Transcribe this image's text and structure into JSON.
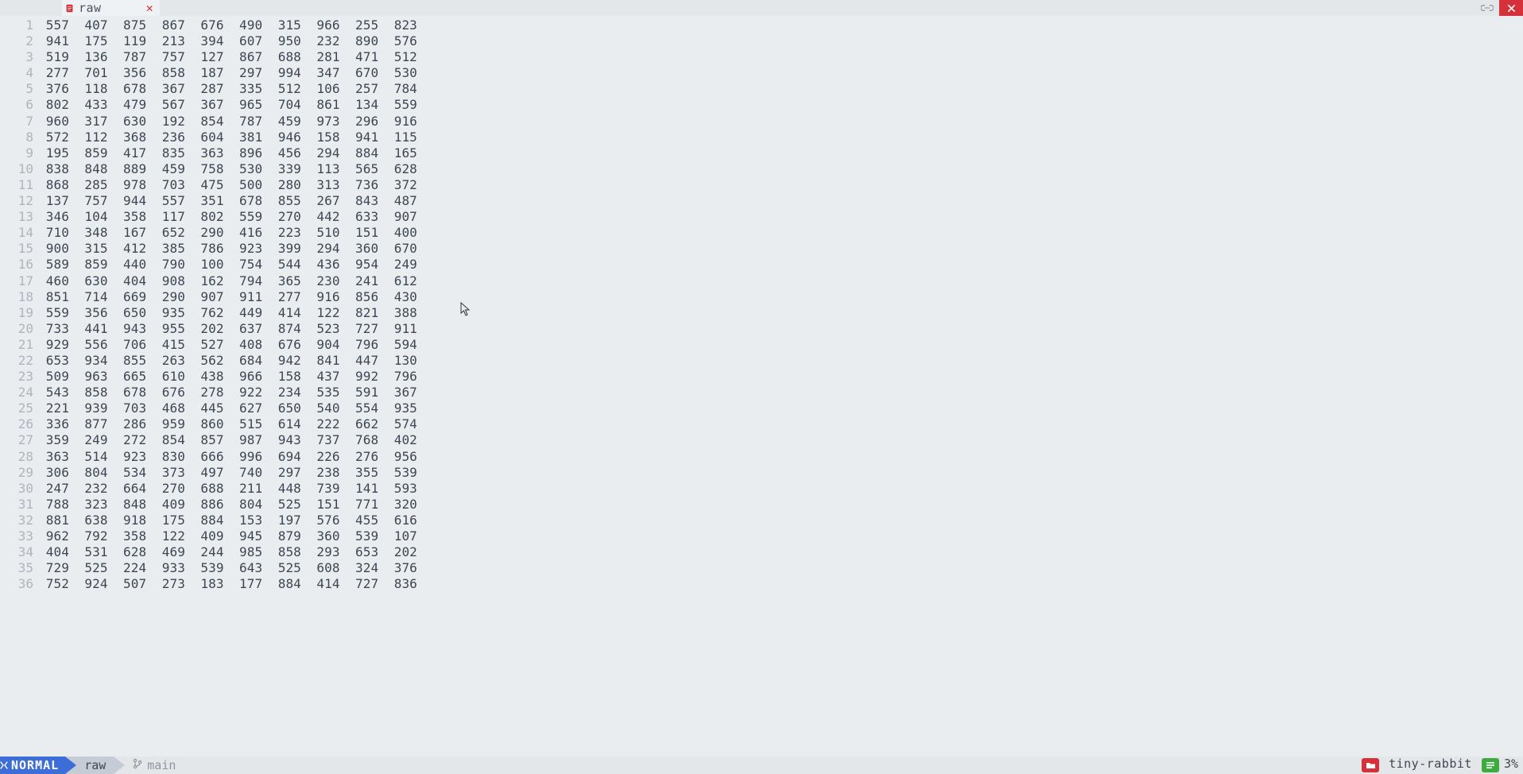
{
  "tabbar": {
    "tab_label": "raw",
    "close_glyph": "✕"
  },
  "editor": {
    "lines": [
      "557  407  875  867  676  490  315  966  255  823",
      "941  175  119  213  394  607  950  232  890  576",
      "519  136  787  757  127  867  688  281  471  512",
      "277  701  356  858  187  297  994  347  670  530",
      "376  118  678  367  287  335  512  106  257  784",
      "802  433  479  567  367  965  704  861  134  559",
      "960  317  630  192  854  787  459  973  296  916",
      "572  112  368  236  604  381  946  158  941  115",
      "195  859  417  835  363  896  456  294  884  165",
      "838  848  889  459  758  530  339  113  565  628",
      "868  285  978  703  475  500  280  313  736  372",
      "137  757  944  557  351  678  855  267  843  487",
      "346  104  358  117  802  559  270  442  633  907",
      "710  348  167  652  290  416  223  510  151  400",
      "900  315  412  385  786  923  399  294  360  670",
      "589  859  440  790  100  754  544  436  954  249",
      "460  630  404  908  162  794  365  230  241  612",
      "851  714  669  290  907  911  277  916  856  430",
      "559  356  650  935  762  449  414  122  821  388",
      "733  441  943  955  202  637  874  523  727  911",
      "929  556  706  415  527  408  676  904  796  594",
      "653  934  855  263  562  684  942  841  447  130",
      "509  963  665  610  438  966  158  437  992  796",
      "543  858  678  676  278  922  234  535  591  367",
      "221  939  703  468  445  627  650  540  554  935",
      "336  877  286  959  860  515  614  222  662  574",
      "359  249  272  854  857  987  943  737  768  402",
      "363  514  923  830  666  996  694  226  276  956",
      "306  804  534  373  497  740  297  238  355  539",
      "247  232  664  270  688  211  448  739  141  593",
      "788  323  848  409  886  804  525  151  771  320",
      "881  638  918  175  884  153  197  576  455  616",
      "962  792  358  122  409  945  879  360  539  107",
      "404  531  628  469  244  985  858  293  653  202",
      "729  525  224  933  539  643  525  608  324  376",
      "752  924  507  273  183  177  884  414  727  836"
    ]
  },
  "statusline": {
    "mode": "NORMAL",
    "filename": "raw",
    "git_branch": "main",
    "hostname": "tiny-rabbit",
    "percent": "3%"
  }
}
